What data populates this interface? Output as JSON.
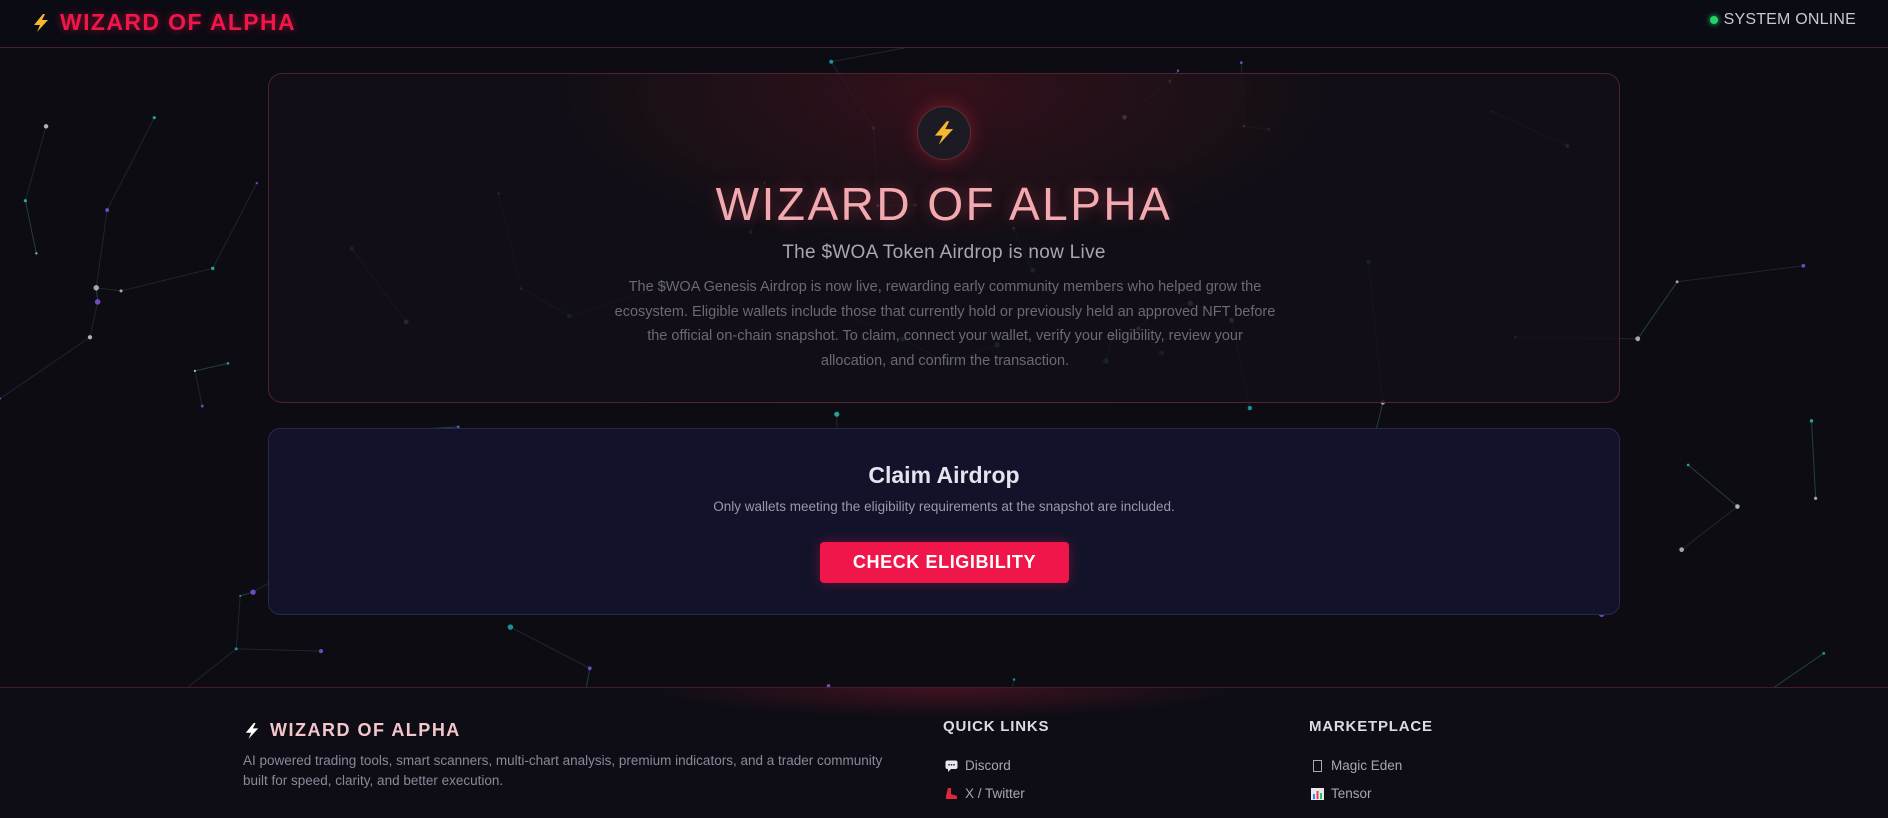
{
  "header": {
    "brand": "WIZARD OF ALPHA",
    "status": "SYSTEM ONLINE"
  },
  "hero": {
    "title": "WIZARD OF ALPHA",
    "subtitle": "The $WOA Token Airdrop is now Live",
    "description": "The $WOA Genesis Airdrop is now live, rewarding early community members who helped grow the ecosystem. Eligible wallets include those that currently hold or previously held an approved NFT before the official on-chain snapshot. To claim, connect your wallet, verify your eligibility, review your allocation, and confirm the transaction."
  },
  "claim": {
    "title": "Claim Airdrop",
    "note": "Only wallets meeting the eligibility requirements at the snapshot are included.",
    "button": "CHECK ELIGIBILITY"
  },
  "footer": {
    "brand": "WIZARD OF ALPHA",
    "description": "AI powered trading tools, smart scanners, multi-chart analysis, premium indicators, and a trader community built for speed, clarity, and better execution.",
    "quick_links": {
      "title": "QUICK LINKS",
      "items": [
        {
          "label": "Discord",
          "icon": "chat-icon"
        },
        {
          "label": "X / Twitter",
          "icon": "red-shoe-icon"
        }
      ]
    },
    "marketplace": {
      "title": "MARKETPLACE",
      "items": [
        {
          "label": "Magic Eden",
          "icon": "missing-glyph-icon"
        },
        {
          "label": "Tensor",
          "icon": "bar-chart-icon"
        }
      ]
    }
  },
  "colors": {
    "accent": "#f0164a",
    "status_online": "#22d36a",
    "background": "#0d0c12",
    "claim_card": "#12132a"
  }
}
